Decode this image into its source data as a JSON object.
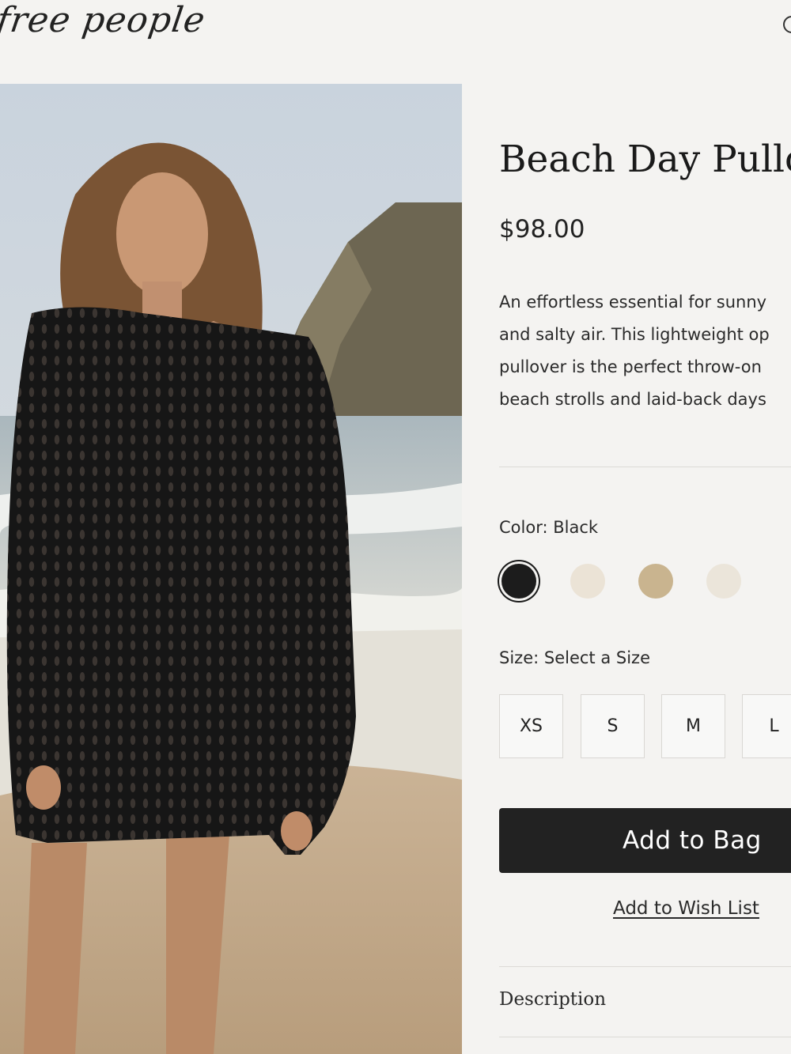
{
  "brand": {
    "logo_text": "free people"
  },
  "product": {
    "title": "Beach Day Pullo",
    "price": "$98.00",
    "description": "An effortless essential for sunny\nand salty air. This lightweight op\npullover is the perfect throw-on\nbeach strolls and laid-back days",
    "color_label": "Color:",
    "color_value": "Black",
    "swatches": [
      {
        "name": "black",
        "color": "#1c1c1c",
        "selected": true
      },
      {
        "name": "cream",
        "color": "#ebe3d6",
        "selected": false
      },
      {
        "name": "tan",
        "color": "#c9b48f",
        "selected": false
      },
      {
        "name": "ivory",
        "color": "#ebe5da",
        "selected": false
      }
    ],
    "size_label": "Size:",
    "size_value": "Select a Size",
    "sizes": [
      "XS",
      "S",
      "M",
      "L"
    ],
    "add_to_bag": "Add to Bag",
    "add_to_wishlist": "Add to Wish List",
    "description_heading": "Description"
  },
  "icons": {
    "header_right": "search-icon"
  }
}
